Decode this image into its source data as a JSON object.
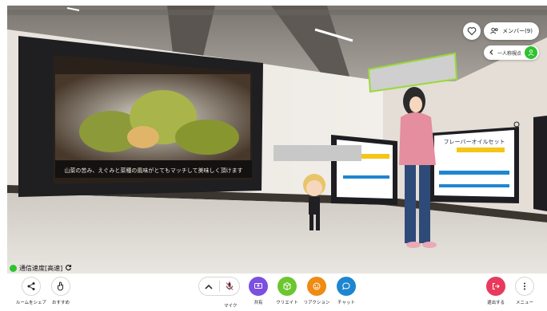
{
  "header": {
    "members_label": "メンバー(9)",
    "view_mode_label": "一人称視点"
  },
  "scene": {
    "screen_caption": "山菜の苦み、えぐみと菜種の風味がとてもマッチして美味しく頂けます",
    "poster_title": "フレーバーオイルセット"
  },
  "status": {
    "connection_label": "通信速度[高速]"
  },
  "toolbar": {
    "share_room_label": "ルームをシェア",
    "recommend_label": "おすすめ",
    "mic_label": "マイク",
    "share_label": "共有",
    "create_label": "クリエイト",
    "reaction_label": "リアクション",
    "chat_label": "チャット",
    "leave_label": "退出する",
    "menu_label": "メニュー"
  },
  "colors": {
    "share": "#7b4fe0",
    "create": "#6cc62e",
    "reaction": "#ef8a12",
    "chat": "#1e86d0",
    "leave": "#e83a5c",
    "connection": "#2ec22f"
  }
}
